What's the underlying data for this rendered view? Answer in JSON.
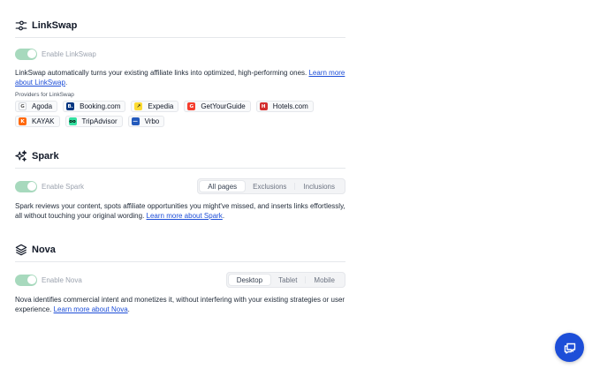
{
  "linkswap": {
    "title": "LinkSwap",
    "icon": "sliders-icon",
    "toggle_label": "Enable LinkSwap",
    "toggle_on": true,
    "description": "LinkSwap automatically turns your existing affiliate links into optimized, high-performing ones. ",
    "learn_more": "Learn more about LinkSwap",
    "description_end": ".",
    "providers_label": "Providers for LinkSwap",
    "providers": [
      {
        "name": "Agoda",
        "logo_text": "G",
        "logo_color": "#ffffff",
        "logo_fg": "#555555"
      },
      {
        "name": "Booking.com",
        "logo_text": "B.",
        "logo_color": "#003580",
        "logo_fg": "#ffffff"
      },
      {
        "name": "Expedia",
        "logo_text": "↗",
        "logo_color": "#fddb32",
        "logo_fg": "#1a1a1a"
      },
      {
        "name": "GetYourGuide",
        "logo_text": "G",
        "logo_color": "#f53d2d",
        "logo_fg": "#ffffff"
      },
      {
        "name": "Hotels.com",
        "logo_text": "H",
        "logo_color": "#d32f2f",
        "logo_fg": "#ffffff"
      },
      {
        "name": "KAYAK",
        "logo_text": "K",
        "logo_color": "#ff690f",
        "logo_fg": "#ffffff"
      },
      {
        "name": "TripAdvisor",
        "logo_text": "oo",
        "logo_color": "#34e0a1",
        "logo_fg": "#000000"
      },
      {
        "name": "Vrbo",
        "logo_text": "—",
        "logo_color": "#245abc",
        "logo_fg": "#ffffff"
      }
    ]
  },
  "spark": {
    "title": "Spark",
    "icon": "sparkles-icon",
    "toggle_label": "Enable Spark",
    "toggle_on": true,
    "tabs": [
      "All pages",
      "Exclusions",
      "Inclusions"
    ],
    "active_tab": "All pages",
    "description": "Spark reviews your content, spots affiliate opportunities you might've missed, and inserts links effortlessly, all without touching your original wording. ",
    "learn_more": "Learn more about Spark",
    "description_end": "."
  },
  "nova": {
    "title": "Nova",
    "icon": "layers-icon",
    "toggle_label": "Enable Nova",
    "toggle_on": true,
    "tabs": [
      "Desktop",
      "Tablet",
      "Mobile"
    ],
    "description": "Nova identifies commercial intent and monetizes it, without interfering with your existing strategies or user experience. ",
    "learn_more": "Learn more about Nova",
    "description_end": "."
  },
  "chat_button": {
    "icon": "chat-bubbles-icon",
    "color": "#1d4ed8"
  }
}
